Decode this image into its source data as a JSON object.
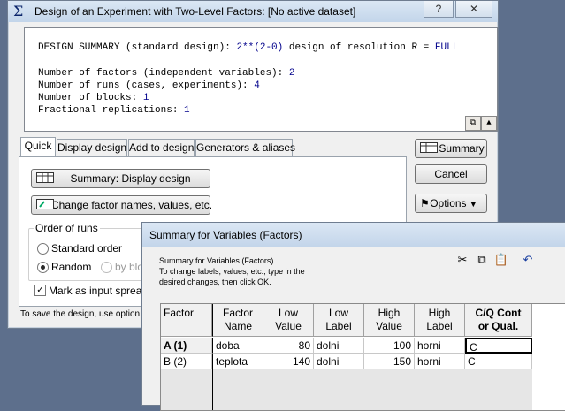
{
  "main_window": {
    "title": "Design of an Experiment with Two-Level Factors: [No active dataset]",
    "help_label": "?",
    "close_label": "✕"
  },
  "summary_output": {
    "line1_prefix": "DESIGN SUMMARY (standard design): ",
    "line1_value": "2**(2-0)",
    "line1_mid": " design of resolution R = ",
    "line1_value2": "FULL",
    "line2_prefix": "Number of factors (independent variables): ",
    "line2_value": "2",
    "line3_prefix": "Number of runs (cases, experiments): ",
    "line3_value": "4",
    "line4_prefix": "Number of blocks: ",
    "line4_value": "1",
    "line5_prefix": "Fractional replications: ",
    "line5_value": "1"
  },
  "tabs": [
    {
      "label": "Quick"
    },
    {
      "label": "Display design"
    },
    {
      "label": "Add to design"
    },
    {
      "label": "Generators & aliases"
    }
  ],
  "quick_panel": {
    "summary_display_design": "Summary:  Display design",
    "change_factor_names": "Change factor names, values, etc.",
    "order_of_runs_label": "Order of runs",
    "standard_order": "Standard order",
    "random": "Random",
    "by_block": "by bloc",
    "mark_as_input": "Mark as input spreadsh",
    "footer_hint": "To save the design, use option \"D"
  },
  "side_buttons": {
    "summary": "Summary",
    "cancel": "Cancel",
    "options": "Options"
  },
  "factors_window": {
    "title": "Summary for Variables (Factors)",
    "instructions_1": "Summary for Variables (Factors)",
    "instructions_2": "To change labels, values, etc., type in the",
    "instructions_3": "desired changes, then click OK.",
    "headers": {
      "factor": "Factor",
      "factor_name": [
        "Factor",
        "Name"
      ],
      "low_value": [
        "Low",
        "Value"
      ],
      "low_label": [
        "Low",
        "Label"
      ],
      "high_value": [
        "High",
        "Value"
      ],
      "high_label": [
        "High",
        "Label"
      ],
      "cq": [
        "C/Q Cont",
        "or Qual."
      ]
    },
    "rows": [
      {
        "factor": "A  (1)",
        "name": "doba",
        "low_value": "80",
        "low_label": "dolni",
        "high_value": "100",
        "high_label": "horni",
        "cq": "C"
      },
      {
        "factor": "B  (2)",
        "name": "teplota",
        "low_value": "140",
        "low_label": "dolni",
        "high_value": "150",
        "high_label": "horni",
        "cq": "C"
      }
    ]
  },
  "colors": {
    "output_blue": "#00008b",
    "desktop": "#5d6f8c"
  }
}
